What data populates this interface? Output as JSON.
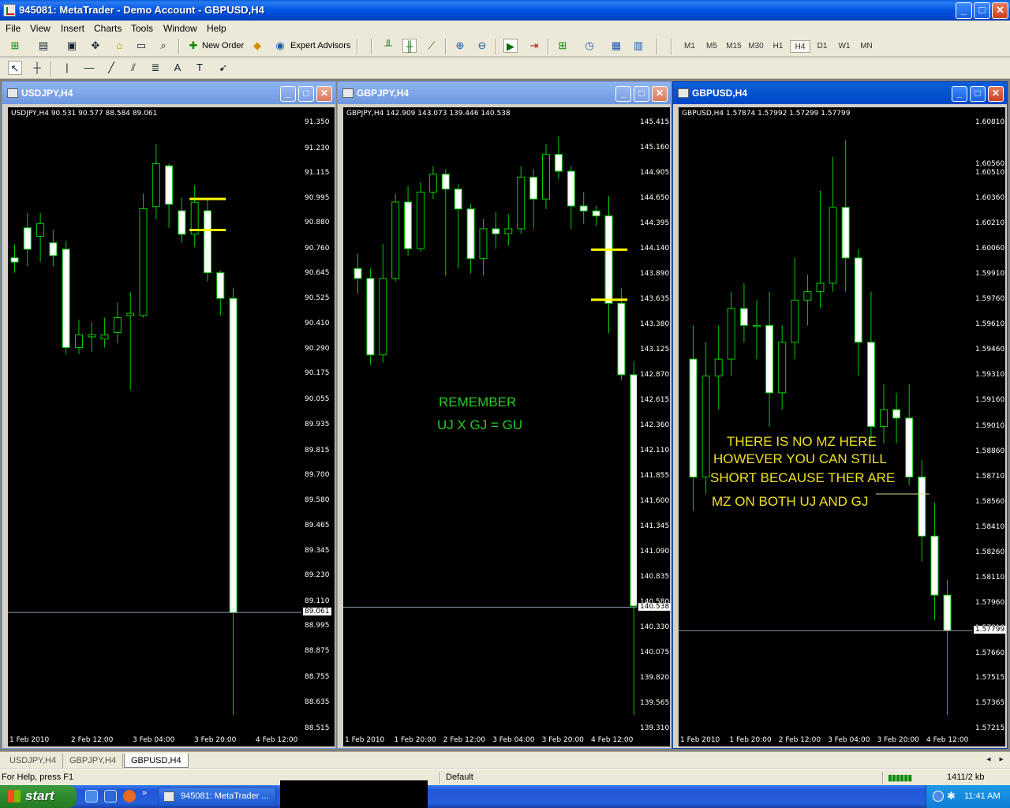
{
  "window": {
    "title": "945081: MetaTrader - Demo Account - GBPUSD,H4",
    "min": "_",
    "max": "□",
    "close": "✕"
  },
  "menu": [
    "File",
    "View",
    "Insert",
    "Charts",
    "Tools",
    "Window",
    "Help"
  ],
  "toolbar": {
    "new_order": "New Order",
    "expert_advisors": "Expert Advisors",
    "timeframes": [
      "M1",
      "M5",
      "M15",
      "M30",
      "H1",
      "H4",
      "D1",
      "W1",
      "MN"
    ],
    "active_timeframe": "H4"
  },
  "charts": [
    {
      "title": "USDJPY,H4",
      "info": "USDJPY,H4  90.531 90.577 88.584 89.061",
      "price_labels": [
        "91.350",
        "91.230",
        "91.115",
        "90.995",
        "90.880",
        "90.760",
        "90.645",
        "90.525",
        "90.410",
        "90.290",
        "90.175",
        "90.055",
        "89.935",
        "89.815",
        "89.700",
        "89.580",
        "89.465",
        "89.345",
        "89.230",
        "89.110",
        "88.995",
        "88.875",
        "88.755",
        "88.635",
        "88.515"
      ],
      "current_price": "89.061",
      "time_labels": [
        "1 Feb 2010",
        "2 Feb 12:00",
        "3 Feb 04:00",
        "3 Feb 20:00",
        "4 Feb 12:00"
      ],
      "annotations": []
    },
    {
      "title": "GBPJPY,H4",
      "info": "GBPJPY,H4  142.909 143.073 139.446 140.538",
      "price_labels": [
        "145.415",
        "145.160",
        "144.905",
        "144.650",
        "144.395",
        "144.140",
        "143.890",
        "143.635",
        "143.380",
        "143.125",
        "142.870",
        "142.615",
        "142.360",
        "142.110",
        "141.855",
        "141.600",
        "141.345",
        "141.090",
        "140.835",
        "140.580",
        "140.330",
        "140.075",
        "139.820",
        "139.565",
        "139.310"
      ],
      "current_price": "140.538",
      "time_labels": [
        "1 Feb 2010",
        "1 Feb 20:00",
        "2 Feb 12:00",
        "3 Feb 04:00",
        "3 Feb 20:00",
        "4 Feb 12:00"
      ],
      "annotations": [
        "REMEMBER",
        "UJ X GJ = GU"
      ]
    },
    {
      "title": "GBPUSD,H4",
      "info": "GBPUSD,H4  1.57874 1.57992 1.57299 1.57799",
      "price_labels": [
        "1.60810",
        "1.60560",
        "1.60510",
        "1.60360",
        "1.60210",
        "1.60060",
        "1.59910",
        "1.59760",
        "1.59610",
        "1.59460",
        "1.59310",
        "1.59160",
        "1.59010",
        "1.58860",
        "1.58710",
        "1.58560",
        "1.58410",
        "1.58260",
        "1.58110",
        "1.57960",
        "1.57810",
        "1.57660",
        "1.57515",
        "1.57365",
        "1.57215"
      ],
      "current_price": "1.57799",
      "time_labels": [
        "1 Feb 2010",
        "1 Feb 20:00",
        "2 Feb 12:00",
        "3 Feb 04:00",
        "3 Feb 20:00",
        "4 Feb 12:00"
      ],
      "annotations": [
        "THERE IS NO MZ HERE",
        "HOWEVER YOU CAN STILL",
        "SHORT BECAUSE THER ARE",
        "MZ ON BOTH UJ AND GJ"
      ]
    }
  ],
  "tabs": [
    "USDJPY,H4",
    "GBPJPY,H4",
    "GBPUSD,H4"
  ],
  "active_tab": "GBPUSD,H4",
  "status": {
    "help": "For Help, press F1",
    "profile": "Default",
    "traffic": "1411/2 kb"
  },
  "taskbar": {
    "start": "start",
    "task": "945081: MetaTrader ...",
    "clock": "11:41 AM"
  },
  "colors": {
    "bull_candle": "#ffffff",
    "candle_wick": "#00cc00",
    "marker": "#ffff00"
  },
  "candles": {
    "usdjpy": [
      [
        90.72,
        90.7,
        90.78,
        90.65
      ],
      [
        90.86,
        90.76,
        90.93,
        90.68
      ],
      [
        90.82,
        90.88,
        90.93,
        90.7
      ],
      [
        90.79,
        90.73,
        90.85,
        90.68
      ],
      [
        90.76,
        90.3,
        90.8,
        90.27
      ],
      [
        90.3,
        90.36,
        90.43,
        90.27
      ],
      [
        90.35,
        90.36,
        90.42,
        90.28
      ],
      [
        90.34,
        90.36,
        90.44,
        90.3
      ],
      [
        90.37,
        90.44,
        90.51,
        90.32
      ],
      [
        90.45,
        90.46,
        90.56,
        90.1
      ],
      [
        90.45,
        90.95,
        91.02,
        90.44
      ],
      [
        90.96,
        91.16,
        91.25,
        90.9
      ],
      [
        91.15,
        90.97,
        91.16,
        90.86
      ],
      [
        90.94,
        90.83,
        91.0,
        90.79
      ],
      [
        90.83,
        90.98,
        91.06,
        90.77
      ],
      [
        90.94,
        90.65,
        91.0,
        90.61
      ],
      [
        90.65,
        90.53,
        90.66,
        90.45
      ],
      [
        90.53,
        89.06,
        90.58,
        88.58
      ]
    ],
    "gbpjpy": [
      [
        143.95,
        143.85,
        144.1,
        143.7
      ],
      [
        143.85,
        143.08,
        143.95,
        142.98
      ],
      [
        143.08,
        143.85,
        144.2,
        143.0
      ],
      [
        143.85,
        144.62,
        144.7,
        143.82
      ],
      [
        144.62,
        144.15,
        144.78,
        144.08
      ],
      [
        144.15,
        144.72,
        144.82,
        144.12
      ],
      [
        144.72,
        144.9,
        144.98,
        144.65
      ],
      [
        144.9,
        144.75,
        144.95,
        143.88
      ],
      [
        144.75,
        144.55,
        144.8,
        143.95
      ],
      [
        144.55,
        144.05,
        144.6,
        143.9
      ],
      [
        144.05,
        144.35,
        144.45,
        143.88
      ],
      [
        144.35,
        144.3,
        144.52,
        144.15
      ],
      [
        144.3,
        144.35,
        144.5,
        144.18
      ],
      [
        144.35,
        144.87,
        144.98,
        144.3
      ],
      [
        144.87,
        144.65,
        144.95,
        144.35
      ],
      [
        144.65,
        145.1,
        145.2,
        144.55
      ],
      [
        145.1,
        144.93,
        145.28,
        144.85
      ],
      [
        144.93,
        144.58,
        144.98,
        144.35
      ],
      [
        144.58,
        144.53,
        144.72,
        144.4
      ],
      [
        144.53,
        144.48,
        144.58,
        144.38
      ],
      [
        144.48,
        143.6,
        144.68,
        143.3
      ],
      [
        143.6,
        142.88,
        143.75,
        142.82
      ],
      [
        142.88,
        140.55,
        143.02,
        139.45
      ]
    ],
    "gbpusd": [
      [
        1.5941,
        1.5871,
        1.5961,
        1.5851
      ],
      [
        1.5871,
        1.5931,
        1.5951,
        1.5861
      ],
      [
        1.5931,
        1.5941,
        1.5961,
        1.5911
      ],
      [
        1.5941,
        1.5971,
        1.5981,
        1.5931
      ],
      [
        1.5971,
        1.5961,
        1.5986,
        1.5951
      ],
      [
        1.5961,
        1.5961,
        1.5976,
        1.5941
      ],
      [
        1.5961,
        1.5921,
        1.5981,
        1.5901
      ],
      [
        1.5921,
        1.5951,
        1.5961,
        1.5911
      ],
      [
        1.5951,
        1.5976,
        1.6001,
        1.5941
      ],
      [
        1.5976,
        1.5981,
        1.5991,
        1.5961
      ],
      [
        1.5981,
        1.5986,
        1.6041,
        1.5971
      ],
      [
        1.5986,
        1.6031,
        1.6061,
        1.5981
      ],
      [
        1.6031,
        1.6001,
        1.6071,
        1.5981
      ],
      [
        1.6001,
        1.5951,
        1.6006,
        1.5931
      ],
      [
        1.5951,
        1.5901,
        1.5981,
        1.5891
      ],
      [
        1.5901,
        1.5911,
        1.5926,
        1.5891
      ],
      [
        1.5911,
        1.5906,
        1.5921,
        1.5891
      ],
      [
        1.5906,
        1.5871,
        1.5926,
        1.5866
      ],
      [
        1.5871,
        1.5836,
        1.5881,
        1.5821
      ],
      [
        1.5836,
        1.5801,
        1.5856,
        1.5786
      ],
      [
        1.5801,
        1.578,
        1.581,
        1.573
      ]
    ]
  }
}
